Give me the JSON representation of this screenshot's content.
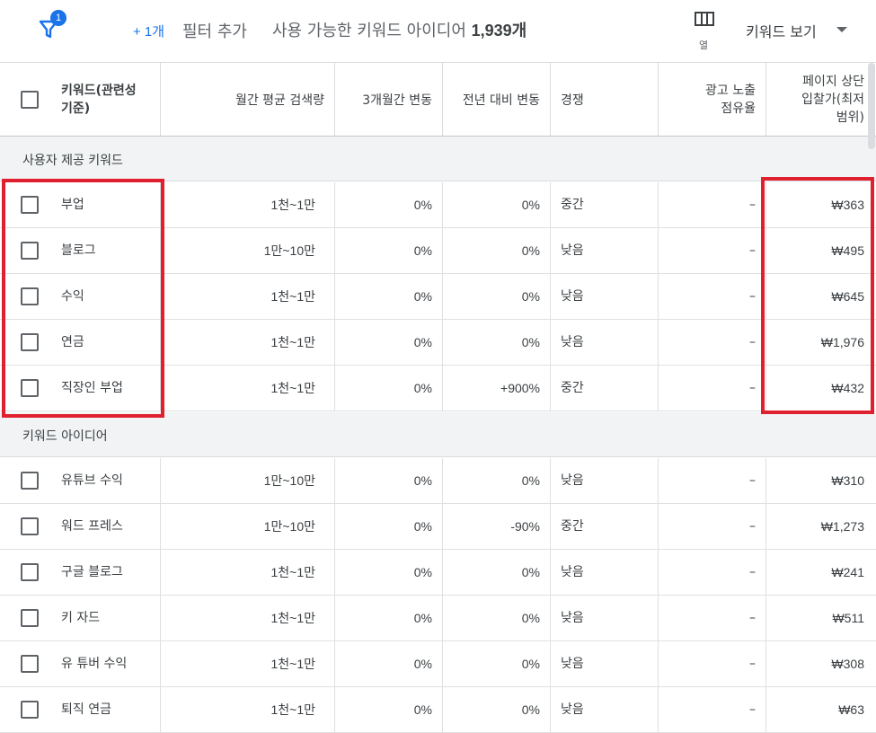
{
  "toolbar": {
    "filter_badge": "1",
    "plus_count": "+ 1개",
    "add_filter": "필터 추가",
    "available_text": "사용 가능한 키워드 아이디어",
    "available_count": "1,939개",
    "columns_label": "열",
    "view_label": "키워드 보기"
  },
  "header": {
    "keyword": [
      "키워드(관련성",
      "기준)"
    ],
    "monthly": "월간 평균 검색량",
    "three_month": "3개월간 변동",
    "yoy": "전년 대비 변동",
    "competition": "경쟁",
    "ad_share": [
      "광고 노출",
      "점유율"
    ],
    "top_bid": [
      "페이지 상단",
      "입찰가(최저",
      "범위)"
    ]
  },
  "sections": [
    {
      "label": "사용자 제공 키워드",
      "rows": [
        {
          "keyword": "부업",
          "monthly": "1천~1만",
          "three_month": "0%",
          "yoy": "0%",
          "competition": "중간",
          "ad_share": "–",
          "bid": "₩363"
        },
        {
          "keyword": "블로그",
          "monthly": "1만~10만",
          "three_month": "0%",
          "yoy": "0%",
          "competition": "낮음",
          "ad_share": "–",
          "bid": "₩495"
        },
        {
          "keyword": "수익",
          "monthly": "1천~1만",
          "three_month": "0%",
          "yoy": "0%",
          "competition": "낮음",
          "ad_share": "–",
          "bid": "₩645"
        },
        {
          "keyword": "연금",
          "monthly": "1천~1만",
          "three_month": "0%",
          "yoy": "0%",
          "competition": "낮음",
          "ad_share": "–",
          "bid": "₩1,976"
        },
        {
          "keyword": "직장인 부업",
          "monthly": "1천~1만",
          "three_month": "0%",
          "yoy": "+900%",
          "competition": "중간",
          "ad_share": "–",
          "bid": "₩432"
        }
      ]
    },
    {
      "label": "키워드 아이디어",
      "rows": [
        {
          "keyword": "유튜브 수익",
          "monthly": "1만~10만",
          "three_month": "0%",
          "yoy": "0%",
          "competition": "낮음",
          "ad_share": "–",
          "bid": "₩310"
        },
        {
          "keyword": "워드 프레스",
          "monthly": "1만~10만",
          "three_month": "0%",
          "yoy": "-90%",
          "competition": "중간",
          "ad_share": "–",
          "bid": "₩1,273"
        },
        {
          "keyword": "구글 블로그",
          "monthly": "1천~1만",
          "three_month": "0%",
          "yoy": "0%",
          "competition": "낮음",
          "ad_share": "–",
          "bid": "₩241"
        },
        {
          "keyword": "키 자드",
          "monthly": "1천~1만",
          "three_month": "0%",
          "yoy": "0%",
          "competition": "낮음",
          "ad_share": "–",
          "bid": "₩511"
        },
        {
          "keyword": "유 튜버 수익",
          "monthly": "1천~1만",
          "three_month": "0%",
          "yoy": "0%",
          "competition": "낮음",
          "ad_share": "–",
          "bid": "₩308"
        },
        {
          "keyword": "퇴직 연금",
          "monthly": "1천~1만",
          "three_month": "0%",
          "yoy": "0%",
          "competition": "낮음",
          "ad_share": "–",
          "bid": "₩63"
        }
      ]
    }
  ],
  "colors": {
    "accent": "#1a73e8",
    "highlight": "#e0202e"
  }
}
